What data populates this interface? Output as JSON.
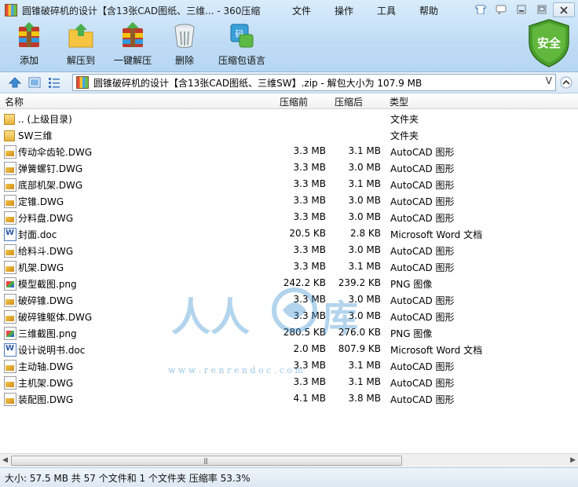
{
  "window": {
    "title": "圆锥破碎机的设计【含13张CAD图纸、三维... - 360压缩"
  },
  "menu": [
    "文件",
    "操作",
    "工具",
    "帮助"
  ],
  "toolbar": [
    {
      "label": "添加",
      "icon": "add-archive-icon"
    },
    {
      "label": "解压到",
      "icon": "extract-to-icon"
    },
    {
      "label": "一键解压",
      "icon": "one-click-extract-icon"
    },
    {
      "label": "删除",
      "icon": "trash-icon"
    },
    {
      "label": "压缩包语言",
      "icon": "archive-language-icon"
    }
  ],
  "security_badge": "安全",
  "address": {
    "path": "圆锥破碎机的设计【含13张CAD图纸、三维SW】.zip - 解包大小为 107.9 MB",
    "dropdown": "V"
  },
  "columns": {
    "name": "名称",
    "size": "压缩前",
    "packed": "压缩后",
    "type": "类型"
  },
  "files": [
    {
      "name": ".. (上级目录)",
      "size": "",
      "packed": "",
      "type": "文件夹",
      "icon": "folder"
    },
    {
      "name": "SW三维",
      "size": "",
      "packed": "",
      "type": "文件夹",
      "icon": "folder"
    },
    {
      "name": "传动伞齿轮.DWG",
      "size": "3.3 MB",
      "packed": "3.1 MB",
      "type": "AutoCAD 图形",
      "icon": "dwg"
    },
    {
      "name": "弹簧螺钉.DWG",
      "size": "3.3 MB",
      "packed": "3.0 MB",
      "type": "AutoCAD 图形",
      "icon": "dwg"
    },
    {
      "name": "底部机架.DWG",
      "size": "3.3 MB",
      "packed": "3.1 MB",
      "type": "AutoCAD 图形",
      "icon": "dwg"
    },
    {
      "name": "定锥.DWG",
      "size": "3.3 MB",
      "packed": "3.0 MB",
      "type": "AutoCAD 图形",
      "icon": "dwg"
    },
    {
      "name": "分料盘.DWG",
      "size": "3.3 MB",
      "packed": "3.0 MB",
      "type": "AutoCAD 图形",
      "icon": "dwg"
    },
    {
      "name": "封面.doc",
      "size": "20.5 KB",
      "packed": "2.8 KB",
      "type": "Microsoft Word 文档",
      "icon": "doc"
    },
    {
      "name": "给料斗.DWG",
      "size": "3.3 MB",
      "packed": "3.0 MB",
      "type": "AutoCAD 图形",
      "icon": "dwg"
    },
    {
      "name": "机架.DWG",
      "size": "3.3 MB",
      "packed": "3.1 MB",
      "type": "AutoCAD 图形",
      "icon": "dwg"
    },
    {
      "name": "模型截图.png",
      "size": "242.2 KB",
      "packed": "239.2 KB",
      "type": "PNG 图像",
      "icon": "png"
    },
    {
      "name": "破碎锥.DWG",
      "size": "3.3 MB",
      "packed": "3.0 MB",
      "type": "AutoCAD 图形",
      "icon": "dwg"
    },
    {
      "name": "破碎锥躯体.DWG",
      "size": "3.3 MB",
      "packed": "3.0 MB",
      "type": "AutoCAD 图形",
      "icon": "dwg"
    },
    {
      "name": "三维截图.png",
      "size": "280.5 KB",
      "packed": "276.0 KB",
      "type": "PNG 图像",
      "icon": "png"
    },
    {
      "name": "设计说明书.doc",
      "size": "2.0 MB",
      "packed": "807.9 KB",
      "type": "Microsoft Word 文档",
      "icon": "doc"
    },
    {
      "name": "主动轴.DWG",
      "size": "3.3 MB",
      "packed": "3.1 MB",
      "type": "AutoCAD 图形",
      "icon": "dwg"
    },
    {
      "name": "主机架.DWG",
      "size": "3.3 MB",
      "packed": "3.1 MB",
      "type": "AutoCAD 图形",
      "icon": "dwg"
    },
    {
      "name": "装配图.DWG",
      "size": "4.1 MB",
      "packed": "3.8 MB",
      "type": "AutoCAD 图形",
      "icon": "dwg"
    }
  ],
  "watermark": {
    "text": "人人文库",
    "url": "w w w . r e n r e n d o c . c o m"
  },
  "status": "大小: 57.5 MB 共 57 个文件和 1 个文件夹 压缩率 53.3%",
  "colors": {
    "chrome": "#bfdcf5",
    "shield": "#4aa02c",
    "watermark": "#3a8fd0"
  }
}
